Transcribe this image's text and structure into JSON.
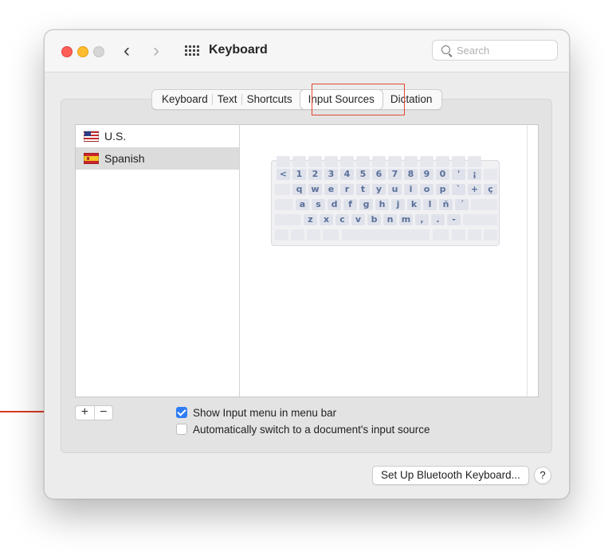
{
  "window": {
    "title": "Keyboard",
    "search_placeholder": "Search"
  },
  "tabs": [
    "Keyboard",
    "Text",
    "Shortcuts",
    "Input Sources",
    "Dictation"
  ],
  "active_tab": "Input Sources",
  "input_sources": [
    {
      "label": "U.S.",
      "flag": "us-flag-icon",
      "selected": false
    },
    {
      "label": "Spanish",
      "flag": "spain-flag-icon",
      "selected": true
    }
  ],
  "keyboard_preview": {
    "rows": [
      [
        "<",
        "1",
        "2",
        "3",
        "4",
        "5",
        "6",
        "7",
        "8",
        "9",
        "0",
        "'",
        "¡"
      ],
      [
        "q",
        "w",
        "e",
        "r",
        "t",
        "y",
        "u",
        "i",
        "o",
        "p",
        "`",
        "+",
        "ç"
      ],
      [
        "a",
        "s",
        "d",
        "f",
        "g",
        "h",
        "j",
        "k",
        "l",
        "ñ",
        "´"
      ],
      [
        "z",
        "x",
        "c",
        "v",
        "b",
        "n",
        "m",
        ",",
        ".",
        "-"
      ]
    ]
  },
  "controls": {
    "add_label": "+",
    "remove_label": "−",
    "show_input_menu": {
      "label": "Show Input menu in menu bar",
      "checked": true
    },
    "auto_switch": {
      "label": "Automatically switch to a document's input source",
      "checked": false
    }
  },
  "buttons": {
    "bluetooth": "Set Up Bluetooth Keyboard...",
    "help": "?"
  },
  "colors": {
    "annotation": "#d83a22",
    "accent": "#2f7cf6"
  }
}
